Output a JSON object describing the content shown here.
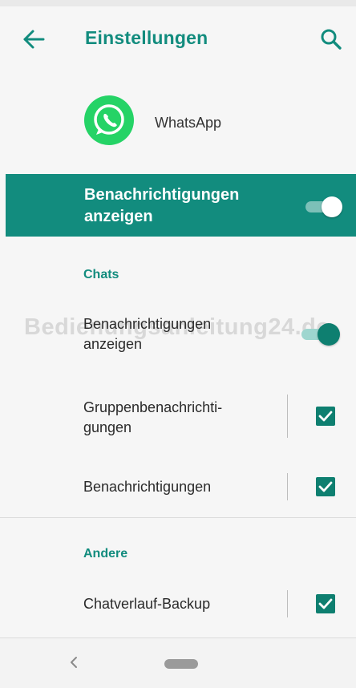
{
  "header": {
    "title": "Einstellungen",
    "back_icon": "arrow-left-icon",
    "search_icon": "search-icon"
  },
  "app": {
    "name": "WhatsApp",
    "logo_icon": "whatsapp-logo-icon"
  },
  "master_toggle": {
    "label_line1": "Benachrichtigungen",
    "label_line2": "anzeigen",
    "checked": true
  },
  "sections": {
    "chats": {
      "header": "Chats",
      "items": [
        {
          "line1": "Benachrichtigungen",
          "line2": "anzeigen",
          "control": "switch",
          "checked": true
        },
        {
          "line1": "Gruppenbenachrichti-",
          "line2": "gungen",
          "control": "checkbox",
          "checked": true
        },
        {
          "line1": "Benachrichtigungen",
          "control": "checkbox",
          "checked": true
        }
      ]
    },
    "other": {
      "header": "Andere",
      "items": [
        {
          "line1": "Chatverlauf-Backup",
          "control": "checkbox",
          "checked": true
        }
      ]
    }
  },
  "watermark": "Bedienungsanleitung24.de",
  "colors": {
    "accent": "#128c7e",
    "accent_dark": "#0e7f70",
    "whatsapp_green": "#25d366",
    "background": "#f6f6f6"
  },
  "nav": {
    "back_icon": "nav-back-chevron-icon",
    "home_icon": "nav-home-pill-icon"
  }
}
